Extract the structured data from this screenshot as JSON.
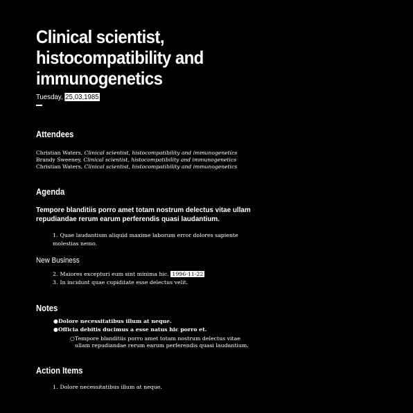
{
  "title": "Clinical scientist, histocompatibility and immunogenetics",
  "date_prefix": "Tuesday, ",
  "date_highlight": "25,03,1985",
  "sections": {
    "attendees": "Attendees",
    "agenda": "Agenda",
    "new_business": "New Business",
    "notes": "Notes",
    "action_items": "Action Items"
  },
  "attendees": [
    {
      "name": "Christian Waters, ",
      "role": "Clinical scientist, histocompatibility and immunogenetics"
    },
    {
      "name": "Brandy Sweeney, ",
      "role": "Clinical scientist, histocompatibility and immunogenetics"
    },
    {
      "name": "Christian Waters, ",
      "role": "Clinical scientist, histocompatibility and immunogenetics"
    }
  ],
  "agenda": {
    "summary": "Tempore blanditiis porro amet totam nostrum delectus vitae ullam repudiandae rerum earum perferendis quasi laudantium.",
    "items": [
      {
        "num": "1.",
        "text": "Quae laudantium aliquid maxime laborum error dolores sapiente molestias nemo."
      }
    ]
  },
  "new_business": {
    "items": [
      {
        "num": "2.",
        "text": "Maiores excepturi eum sint minima hic. ",
        "chip": "1996-11-22"
      },
      {
        "num": "3.",
        "text": "In incidunt quae cupiditate esse delectus velit."
      }
    ]
  },
  "notes": {
    "items": [
      {
        "text": "Dolore necessitatibus illum at neque."
      },
      {
        "text": "Officia debitis ducimus a esse natus hic porro et."
      }
    ],
    "sub": "Tempore blanditiis porro amet totam nostrum delectus vitae ullam repudiandae rerum earum perferendis quasi laudantium."
  },
  "action_items": [
    {
      "num": "1.",
      "text": "Dolore necessitatibus illum at neque."
    }
  ],
  "colors": {
    "background": "#000000",
    "text": "#ffffff"
  }
}
